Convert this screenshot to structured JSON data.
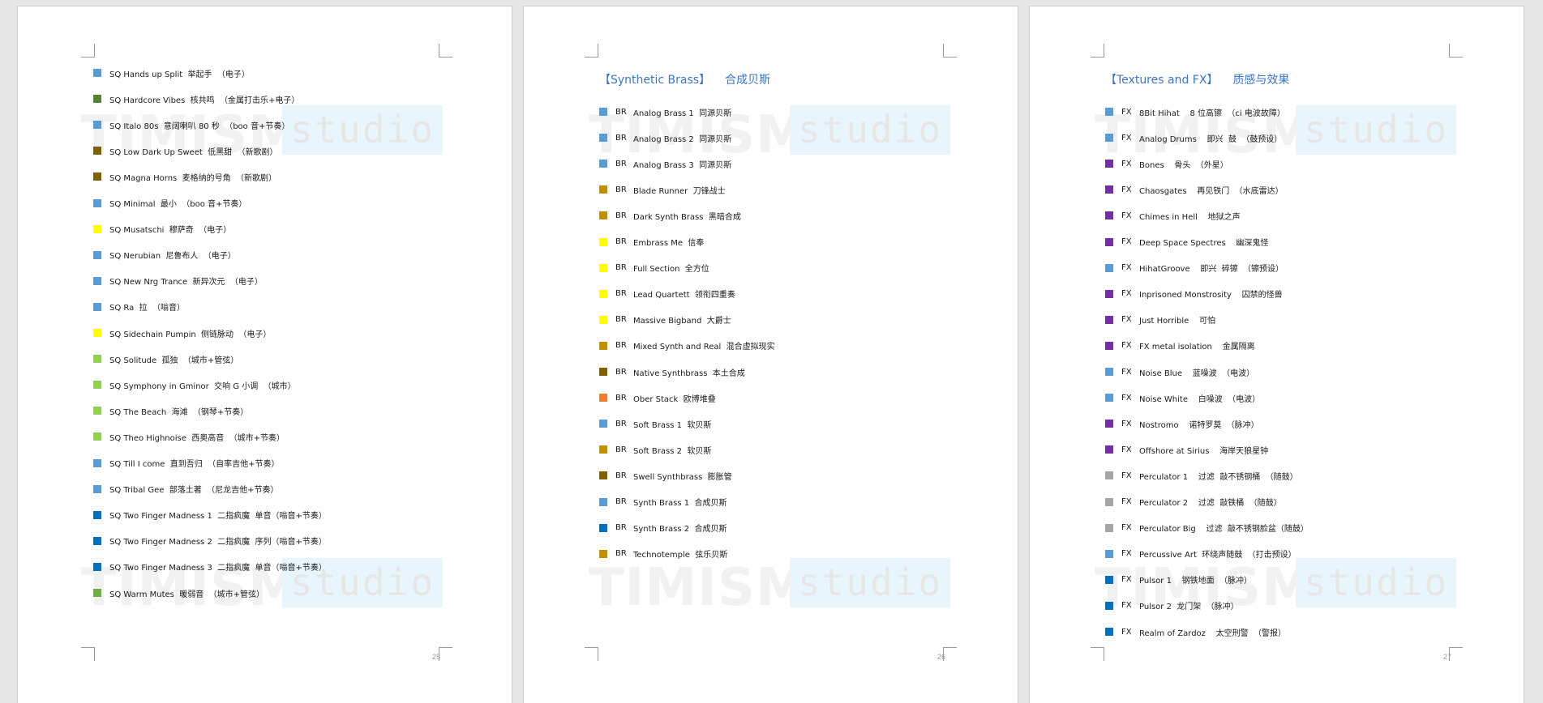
{
  "watermark": {
    "brand": "TIMISM",
    "studio": "studio"
  },
  "pages": [
    {
      "page_number": "25",
      "heading": null,
      "entries": [
        {
          "tag": "",
          "text": "SQ Hands up Split  举起手  （电子）",
          "color": "#5b9bd5"
        },
        {
          "tag": "",
          "text": "SQ Hardcore Vibes  核共鸣  （金属打击乐+电子）",
          "color": "#548235"
        },
        {
          "tag": "",
          "text": "SQ Italo 80s  意阔喇叭 80 秒  （boo 音+节奏）",
          "color": "#5b9bd5"
        },
        {
          "tag": "",
          "text": "SQ Low Dark Up Sweet  低黑甜  （新歌剧）",
          "color": "#7f6000"
        },
        {
          "tag": "",
          "text": "SQ Magna Horns  麦格纳的号角  （新歌剧）",
          "color": "#7f6000"
        },
        {
          "tag": "",
          "text": "SQ Minimal  最小  （boo 音+节奏）",
          "color": "#5b9bd5"
        },
        {
          "tag": "",
          "text": "SQ Musatschi  穆萨奇  （电子）",
          "color": "#ffff00"
        },
        {
          "tag": "",
          "text": "SQ Nerubian  尼鲁布人  （电子）",
          "color": "#5b9bd5"
        },
        {
          "tag": "",
          "text": "SQ New Nrg Trance  新异次元  （电子）",
          "color": "#5b9bd5"
        },
        {
          "tag": "",
          "text": "SQ Ra  拉  （嗡音）",
          "color": "#5b9bd5"
        },
        {
          "tag": "",
          "text": "SQ Sidechain Pumpin  侧链脉动  （电子）",
          "color": "#ffff00"
        },
        {
          "tag": "",
          "text": "SQ Solitude  孤独  （城市+管弦）",
          "color": "#92d050"
        },
        {
          "tag": "",
          "text": "SQ Symphony in Gminor  交响 G 小调  （城市）",
          "color": "#92d050"
        },
        {
          "tag": "",
          "text": "SQ The Beach  海滩  （钢琴+节奏）",
          "color": "#92d050"
        },
        {
          "tag": "",
          "text": "SQ Theo Highnoise  西奥高音  （城市+节奏）",
          "color": "#92d050"
        },
        {
          "tag": "",
          "text": "SQ Till I come  直到吾归  （自率吉他+节奏）",
          "color": "#5b9bd5"
        },
        {
          "tag": "",
          "text": "SQ Tribal Gee  部落土著  （尼龙吉他+节奏）",
          "color": "#5b9bd5"
        },
        {
          "tag": "",
          "text": "SQ Two Finger Madness 1  二指疯魔  单音（嗡音+节奏）",
          "color": "#0070c0"
        },
        {
          "tag": "",
          "text": "SQ Two Finger Madness 2  二指疯魔  序列（嗡音+节奏）",
          "color": "#0070c0"
        },
        {
          "tag": "",
          "text": "SQ Two Finger Madness 3  二指疯魔  单音（嗡音+节奏）",
          "color": "#0070c0"
        },
        {
          "tag": "",
          "text": "SQ Warm Mutes  暖弱音  （城市+管弦）",
          "color": "#70ad47"
        }
      ]
    },
    {
      "page_number": "26",
      "heading": {
        "en": "【Synthetic Brass】",
        "cn": "合成贝斯"
      },
      "entries": [
        {
          "tag": "BR",
          "text": "Analog Brass 1  同源贝斯",
          "color": "#5b9bd5"
        },
        {
          "tag": "BR",
          "text": "Analog Brass 2  同源贝斯",
          "color": "#5b9bd5"
        },
        {
          "tag": "BR",
          "text": "Analog Brass 3  同源贝斯",
          "color": "#5b9bd5"
        },
        {
          "tag": "BR",
          "text": "Blade Runner  刀锋战士",
          "color": "#bf9000"
        },
        {
          "tag": "BR",
          "text": "Dark Synth Brass  黑暗合成",
          "color": "#bf9000"
        },
        {
          "tag": "BR",
          "text": "Embrass Me  信奉",
          "color": "#ffff00"
        },
        {
          "tag": "BR",
          "text": "Full Section  全方位",
          "color": "#ffff00"
        },
        {
          "tag": "BR",
          "text": "Lead Quartett  领衔四重奏",
          "color": "#ffff00"
        },
        {
          "tag": "BR",
          "text": "Massive Bigband  大爵士",
          "color": "#ffff00"
        },
        {
          "tag": "BR",
          "text": "Mixed Synth and Real  混合虚拟现实",
          "color": "#bf9000"
        },
        {
          "tag": "BR",
          "text": "Native Synthbrass  本土合成",
          "color": "#7f6000"
        },
        {
          "tag": "BR",
          "text": "Ober Stack  欧博堆叠",
          "color": "#ed7d31"
        },
        {
          "tag": "BR",
          "text": "Soft Brass 1  软贝斯",
          "color": "#5b9bd5"
        },
        {
          "tag": "BR",
          "text": "Soft Brass 2  软贝斯",
          "color": "#bf9000"
        },
        {
          "tag": "BR",
          "text": "Swell Synthbrass  膨胀管",
          "color": "#7f6000"
        },
        {
          "tag": "BR",
          "text": "Synth Brass 1  合成贝斯",
          "color": "#5b9bd5"
        },
        {
          "tag": "BR",
          "text": "Synth Brass 2  合成贝斯",
          "color": "#0070c0"
        },
        {
          "tag": "BR",
          "text": "Technotemple  弦乐贝斯",
          "color": "#bf9000"
        }
      ]
    },
    {
      "page_number": "27",
      "heading": {
        "en": "【Textures and FX】",
        "cn": "质感与效果"
      },
      "entries": [
        {
          "tag": "FX",
          "text": "8Bit Hihat    8 位高镲  （ci 电波故障）",
          "color": "#5b9bd5"
        },
        {
          "tag": "FX",
          "text": "Analog Drums    即兴  鼓  （鼓预设）",
          "color": "#5b9bd5"
        },
        {
          "tag": "FX",
          "text": "Bones    骨头  （外星）",
          "color": "#7030a0"
        },
        {
          "tag": "FX",
          "text": "Chaosgates    再见铁门  （水底雷达）",
          "color": "#7030a0"
        },
        {
          "tag": "FX",
          "text": "Chimes in Hell    地狱之声",
          "color": "#7030a0"
        },
        {
          "tag": "FX",
          "text": "Deep Space Spectres    幽深鬼怪",
          "color": "#7030a0"
        },
        {
          "tag": "FX",
          "text": "HihatGroove    即兴  碎镲  （镲预设）",
          "color": "#5b9bd5"
        },
        {
          "tag": "FX",
          "text": "Inprisoned Monstrosity    囚禁的怪兽",
          "color": "#7030a0"
        },
        {
          "tag": "FX",
          "text": "Just Horrible    可怕",
          "color": "#7030a0"
        },
        {
          "tag": "FX",
          "text": "FX metal isolation    金属隔离",
          "color": "#7030a0"
        },
        {
          "tag": "FX",
          "text": "Noise Blue    蓝噪波  （电波）",
          "color": "#5b9bd5"
        },
        {
          "tag": "FX",
          "text": "Noise White    白噪波  （电波）",
          "color": "#5b9bd5"
        },
        {
          "tag": "FX",
          "text": "Nostromo    诺特罗莫  （脉冲）",
          "color": "#7030a0"
        },
        {
          "tag": "FX",
          "text": "Offshore at Sirius    海岸天狼星钟",
          "color": "#7030a0"
        },
        {
          "tag": "FX",
          "text": "Perculator 1    过滤  敲不锈钢桶  （随鼓）",
          "color": "#a5a5a5"
        },
        {
          "tag": "FX",
          "text": "Perculator 2    过滤  敲铁桶  （随鼓）",
          "color": "#a5a5a5"
        },
        {
          "tag": "FX",
          "text": "Perculator Big    过滤  敲不锈钢脸盆（随鼓）",
          "color": "#a5a5a5"
        },
        {
          "tag": "FX",
          "text": "Percussive Art  环绕声随鼓  （打击预设）",
          "color": "#5b9bd5"
        },
        {
          "tag": "FX",
          "text": "Pulsor 1    钢铁地面  （脉冲）",
          "color": "#0070c0"
        },
        {
          "tag": "FX",
          "text": "Pulsor 2  龙门架  （脉冲）",
          "color": "#0070c0"
        },
        {
          "tag": "FX",
          "text": "Realm of Zardoz    太空刑警  （警报）",
          "color": "#0070c0"
        }
      ]
    }
  ]
}
